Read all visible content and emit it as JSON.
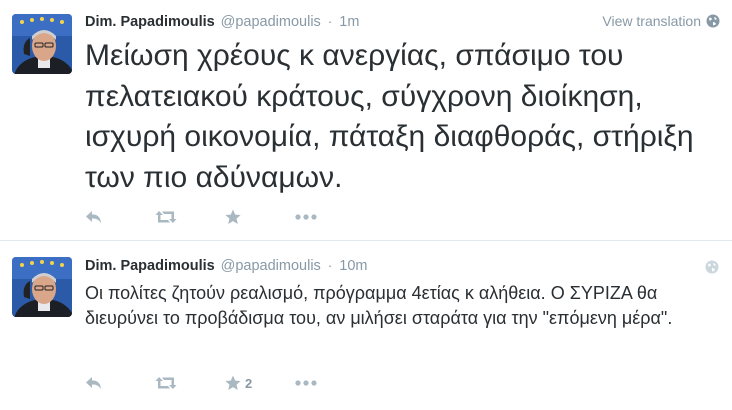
{
  "tweets": [
    {
      "author_name": "Dim. Papadimoulis",
      "author_handle": "@papadimoulis",
      "separator": "·",
      "time": "1m",
      "view_translation": "View translation",
      "text": "Μείωση χρέους κ ανεργίας, σπάσιμο του πελατειακού κράτους, σύγχρονη διοίκηση, ισχυρή οικονομία, πάταξη διαφθοράς, στήριξη των πιο αδύναμων.",
      "favorites_count": ""
    },
    {
      "author_name": "Dim. Papadimoulis",
      "author_handle": "@papadimoulis",
      "separator": "·",
      "time": "10m",
      "text": "Οι πολίτες ζητούν ρεαλισμό, πρόγραμμα 4ετίας κ αλήθεια. Ο ΣΥΡΙΖΑ θα διευρύνει το προβάδισμα του, αν μιλήσει σταράτα για την \"επόμενη μέρα\".",
      "favorites_count": "2"
    }
  ],
  "icons": {
    "reply": "reply-icon",
    "retweet": "retweet-icon",
    "favorite": "star-icon",
    "more": "more-icon",
    "globe": "globe-icon"
  },
  "colors": {
    "text": "#292f33",
    "muted": "#8899a6",
    "divider": "#e1e8ed"
  }
}
